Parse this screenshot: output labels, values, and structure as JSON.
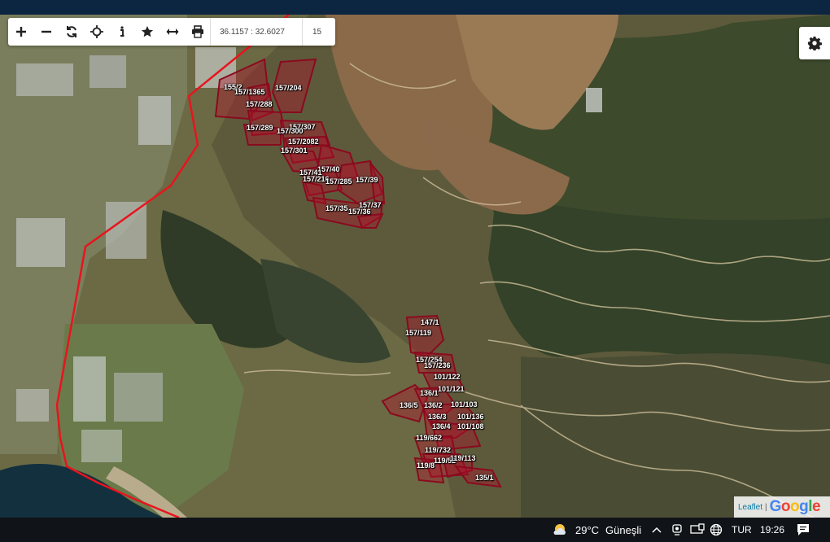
{
  "toolbar": {
    "buttons": [
      {
        "name": "zoom-in-button",
        "icon": "plus-icon"
      },
      {
        "name": "zoom-out-button",
        "icon": "minus-icon"
      },
      {
        "name": "refresh-button",
        "icon": "refresh-icon"
      },
      {
        "name": "locate-button",
        "icon": "crosshair-icon"
      },
      {
        "name": "info-button",
        "icon": "info-icon"
      },
      {
        "name": "favorite-button",
        "icon": "star-icon"
      },
      {
        "name": "measure-button",
        "icon": "arrows-horizontal-icon"
      },
      {
        "name": "print-button",
        "icon": "printer-icon"
      }
    ],
    "coordinates": "36.1157 : 32.6027",
    "zoom_level": "15"
  },
  "settings_icon": "gear-icon",
  "attribution": {
    "leaflet": "Leaflet",
    "separator": "|",
    "google": "Google"
  },
  "parcels": [
    "155/2",
    "157/1365",
    "157/204",
    "157/288",
    "157/289",
    "157/307",
    "157/300",
    "157/2082",
    "157/301",
    "157/40",
    "157/41",
    "157/216",
    "157/285",
    "157/39",
    "157/37",
    "157/35",
    "157/36",
    "147/1",
    "157/119",
    "157/254",
    "157/236",
    "101/122",
    "101/121",
    "136/1",
    "136/5",
    "136/2",
    "101/103",
    "136/3",
    "101/136",
    "136/4",
    "101/108",
    "119/662",
    "119/732",
    "119/52",
    "119/8",
    "119/113",
    "135/1"
  ],
  "colors": {
    "parcel_fill": "#b3102a",
    "parcel_stroke": "#8a0a1e",
    "boundary_line": "#e8141e",
    "taskbar_bg": "#101418"
  },
  "taskbar": {
    "weather_icon": "sun-cloud-icon",
    "temperature": "29°C",
    "weather_text": "Güneşli",
    "language": "TUR",
    "time": "19:26",
    "tray_icons": [
      "chevron-up-icon",
      "webcam-icon",
      "monitor-icon",
      "globe-icon",
      "speaker-icon"
    ],
    "notification_icon": "chat-icon"
  }
}
